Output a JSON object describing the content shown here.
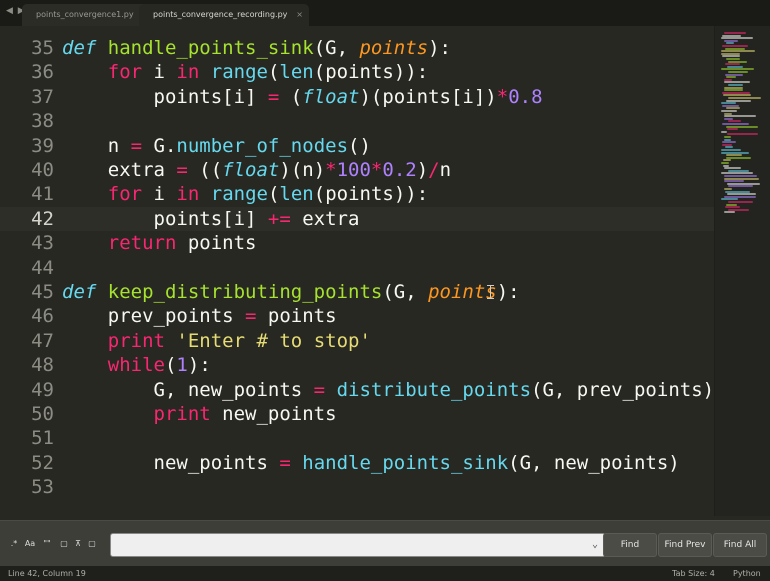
{
  "tabs": [
    {
      "label": "points_convergence1.py",
      "close": "●"
    },
    {
      "label": "points_convergence_recording.py",
      "close": "×"
    }
  ],
  "nav_arrows": "◀ ▶",
  "editor": {
    "lines": [
      {
        "num": "35",
        "tokens": [
          {
            "t": "def",
            "c": "def"
          },
          {
            "t": " "
          },
          {
            "t": "handle_points_sink",
            "c": "fn"
          },
          {
            "t": "(G, "
          },
          {
            "t": "points",
            "c": "param"
          },
          {
            "t": "):"
          }
        ]
      },
      {
        "num": "36",
        "tokens": [
          {
            "t": "    "
          },
          {
            "t": "for",
            "c": "kw"
          },
          {
            "t": " i "
          },
          {
            "t": "in",
            "c": "kw"
          },
          {
            "t": " "
          },
          {
            "t": "range",
            "c": "bi"
          },
          {
            "t": "("
          },
          {
            "t": "len",
            "c": "bi"
          },
          {
            "t": "(points)):"
          }
        ]
      },
      {
        "num": "37",
        "tokens": [
          {
            "t": "        points[i] "
          },
          {
            "t": "=",
            "c": "kw"
          },
          {
            "t": " ("
          },
          {
            "t": "float",
            "c": "def"
          },
          {
            "t": ")(points[i])"
          },
          {
            "t": "*",
            "c": "kw"
          },
          {
            "t": "0.8",
            "c": "num"
          }
        ]
      },
      {
        "num": "38",
        "tokens": []
      },
      {
        "num": "39",
        "tokens": [
          {
            "t": "    n "
          },
          {
            "t": "=",
            "c": "kw"
          },
          {
            "t": " G."
          },
          {
            "t": "number_of_nodes",
            "c": "bi"
          },
          {
            "t": "()"
          }
        ]
      },
      {
        "num": "40",
        "tokens": [
          {
            "t": "    extra "
          },
          {
            "t": "=",
            "c": "kw"
          },
          {
            "t": " (("
          },
          {
            "t": "float",
            "c": "def"
          },
          {
            "t": ")(n)"
          },
          {
            "t": "*",
            "c": "kw"
          },
          {
            "t": "100",
            "c": "num"
          },
          {
            "t": "*",
            "c": "kw"
          },
          {
            "t": "0.2",
            "c": "num"
          },
          {
            "t": ")"
          },
          {
            "t": "/",
            "c": "kw"
          },
          {
            "t": "n"
          }
        ]
      },
      {
        "num": "41",
        "tokens": [
          {
            "t": "    "
          },
          {
            "t": "for",
            "c": "kw"
          },
          {
            "t": " i "
          },
          {
            "t": "in",
            "c": "kw"
          },
          {
            "t": " "
          },
          {
            "t": "range",
            "c": "bi"
          },
          {
            "t": "("
          },
          {
            "t": "len",
            "c": "bi"
          },
          {
            "t": "(points)):"
          }
        ]
      },
      {
        "num": "42",
        "active": true,
        "tokens": [
          {
            "t": "        points[i] "
          },
          {
            "t": "+=",
            "c": "kw"
          },
          {
            "t": " extra"
          }
        ]
      },
      {
        "num": "43",
        "tokens": [
          {
            "t": "    "
          },
          {
            "t": "return",
            "c": "kw"
          },
          {
            "t": " points"
          }
        ]
      },
      {
        "num": "44",
        "tokens": []
      },
      {
        "num": "45",
        "tokens": [
          {
            "t": "def",
            "c": "def"
          },
          {
            "t": " "
          },
          {
            "t": "keep_distributing_points",
            "c": "fn"
          },
          {
            "t": "(G, "
          },
          {
            "t": "points",
            "c": "param"
          },
          {
            "t": "):"
          }
        ]
      },
      {
        "num": "46",
        "tokens": [
          {
            "t": "    prev_points "
          },
          {
            "t": "=",
            "c": "kw"
          },
          {
            "t": " points"
          }
        ]
      },
      {
        "num": "47",
        "tokens": [
          {
            "t": "    "
          },
          {
            "t": "print",
            "c": "kw"
          },
          {
            "t": " "
          },
          {
            "t": "'Enter # to stop'",
            "c": "str"
          }
        ]
      },
      {
        "num": "48",
        "tokens": [
          {
            "t": "    "
          },
          {
            "t": "while",
            "c": "kw"
          },
          {
            "t": "("
          },
          {
            "t": "1",
            "c": "num"
          },
          {
            "t": "):"
          }
        ]
      },
      {
        "num": "49",
        "tokens": [
          {
            "t": "        G, new_points "
          },
          {
            "t": "=",
            "c": "kw"
          },
          {
            "t": " "
          },
          {
            "t": "distribute_points",
            "c": "bi"
          },
          {
            "t": "(G, prev_points)"
          }
        ]
      },
      {
        "num": "50",
        "tokens": [
          {
            "t": "        "
          },
          {
            "t": "print",
            "c": "kw"
          },
          {
            "t": " new_points"
          }
        ]
      },
      {
        "num": "51",
        "tokens": []
      },
      {
        "num": "52",
        "tokens": [
          {
            "t": "        new_points "
          },
          {
            "t": "=",
            "c": "kw"
          },
          {
            "t": " "
          },
          {
            "t": "handle_points_sink",
            "c": "bi"
          },
          {
            "t": "(G, new_points)"
          }
        ]
      },
      {
        "num": "53",
        "tokens": []
      }
    ]
  },
  "find_panel": {
    "options": [
      ".*",
      "Aa",
      "\"\"",
      "▢",
      "⊼",
      "▢"
    ],
    "input_value": "",
    "dropdown_icon": "⌄",
    "buttons": [
      "Find",
      "Find Prev",
      "Find All"
    ]
  },
  "status": {
    "position": "Line 42, Column 19",
    "tab_size": "Tab Size: 4",
    "syntax": "Python"
  },
  "colors": {
    "background": "#272822",
    "keyword": "#f92672",
    "storage": "#66d9ef",
    "function": "#a6e22e",
    "parameter": "#fd971f",
    "number": "#ae81ff",
    "string": "#e6db74"
  }
}
